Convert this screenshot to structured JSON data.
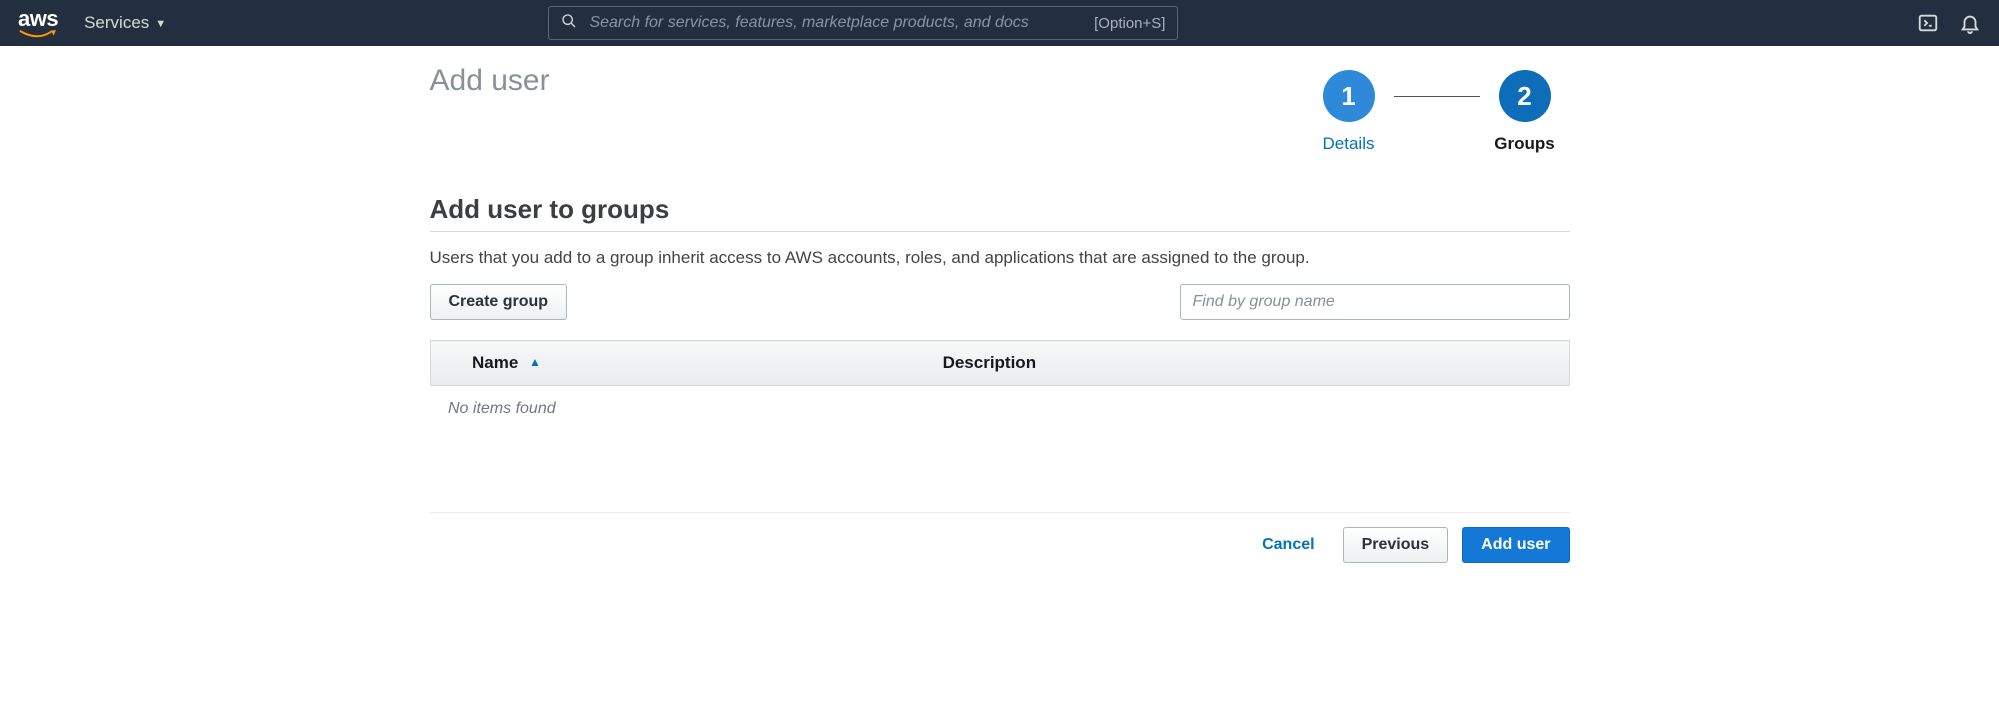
{
  "nav": {
    "logo_text": "aws",
    "services_label": "Services",
    "search_placeholder": "Search for services, features, marketplace products, and docs",
    "search_shortcut": "[Option+S]"
  },
  "wizard": {
    "page_title": "Add user",
    "steps": [
      {
        "num": "1",
        "label": "Details",
        "state": "done"
      },
      {
        "num": "2",
        "label": "Groups",
        "state": "active"
      }
    ]
  },
  "section": {
    "title": "Add user to groups",
    "description": "Users that you add to a group inherit access to AWS accounts, roles, and applications that are assigned to the group.",
    "create_group_label": "Create group",
    "filter_placeholder": "Find by group name"
  },
  "table": {
    "col_name": "Name",
    "col_description": "Description",
    "empty_text": "No items found"
  },
  "footer": {
    "cancel": "Cancel",
    "previous": "Previous",
    "add_user": "Add user"
  }
}
